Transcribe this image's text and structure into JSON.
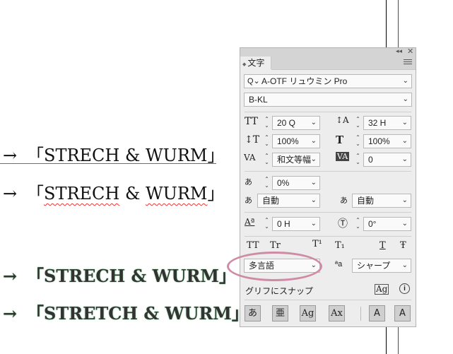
{
  "document": {
    "lines": [
      {
        "arrow": "→",
        "text": "「STRECH & WURM」"
      },
      {
        "arrow": "→",
        "text": "「STRECH & WURM」"
      },
      {
        "arrow": "→",
        "text": "「STRECH & WURM」"
      },
      {
        "arrow": "→",
        "text": "「STRETCH & WURM」"
      }
    ],
    "line2_parts": [
      "「",
      "STRECH",
      " & ",
      "WURM",
      "」"
    ]
  },
  "panel": {
    "tab_label": "文字",
    "collapse_glyph": "◂◂",
    "close_glyph": "✕",
    "font_family": "A-OTF リュウミン Pro",
    "font_style": "B-KL",
    "font_size": "20 Q",
    "leading": "32 H",
    "vertical_scale": "100%",
    "horizontal_scale": "100%",
    "kerning": "和文等幅",
    "tracking": "0",
    "tsume": "0%",
    "aki_before": "自動",
    "aki_after": "自動",
    "baseline_shift": "0 H",
    "rotation": "0°",
    "style_buttons": [
      "TT",
      "Tr",
      "T¹",
      "T₁",
      "T",
      "Ŧ"
    ],
    "language": "多言語",
    "antialias_label": "ªa",
    "antialias": "シャープ",
    "snap_to_glyph": "グリフにスナップ",
    "bottom_buttons": [
      "あ",
      "亜",
      "Ag",
      "Ax",
      "A",
      "A"
    ]
  },
  "colors": {
    "guide_red": "#dd1111",
    "annotation_circle": "#cf8aa5",
    "outline_glow": "#9ad9a8"
  }
}
